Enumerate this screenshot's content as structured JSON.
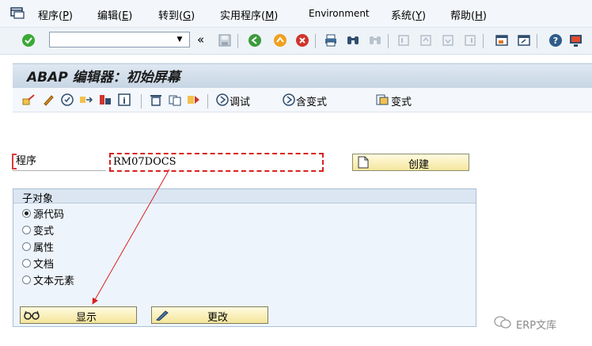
{
  "menu": [
    {
      "label": "程序(",
      "key": "P",
      "tail": ")"
    },
    {
      "label": "编辑(",
      "key": "E",
      "tail": ")"
    },
    {
      "label": "转到(",
      "key": "G",
      "tail": ")"
    },
    {
      "label": "实用程序(",
      "key": "M",
      "tail": ")"
    },
    {
      "label": "Environment",
      "key": "",
      "tail": ""
    },
    {
      "label": "系统(",
      "key": "Y",
      "tail": ")"
    },
    {
      "label": "帮助(",
      "key": "H",
      "tail": ")"
    }
  ],
  "toolbar": {
    "command_value": "",
    "back_chevron": "«"
  },
  "title": "ABAP 编辑器：初始屏幕",
  "app_toolbar": {
    "debug_label": "调试",
    "with_variant_label": "含变式",
    "variant_label": "变式"
  },
  "program": {
    "label": "程序",
    "value": "RM07DOCS",
    "create_label": "创建"
  },
  "subobjects": {
    "title": "子对象",
    "options": [
      {
        "label": "源代码",
        "selected": true
      },
      {
        "label": "变式",
        "selected": false
      },
      {
        "label": "属性",
        "selected": false
      },
      {
        "label": "文档",
        "selected": false
      },
      {
        "label": "文本元素",
        "selected": false
      }
    ]
  },
  "buttons": {
    "display_label": "显示",
    "change_label": "更改"
  },
  "watermark": "ERP文库",
  "colors": {
    "accent_red": "#d82020",
    "title_bg": "#c7d5e4",
    "button_bg": "#f4e59a"
  }
}
